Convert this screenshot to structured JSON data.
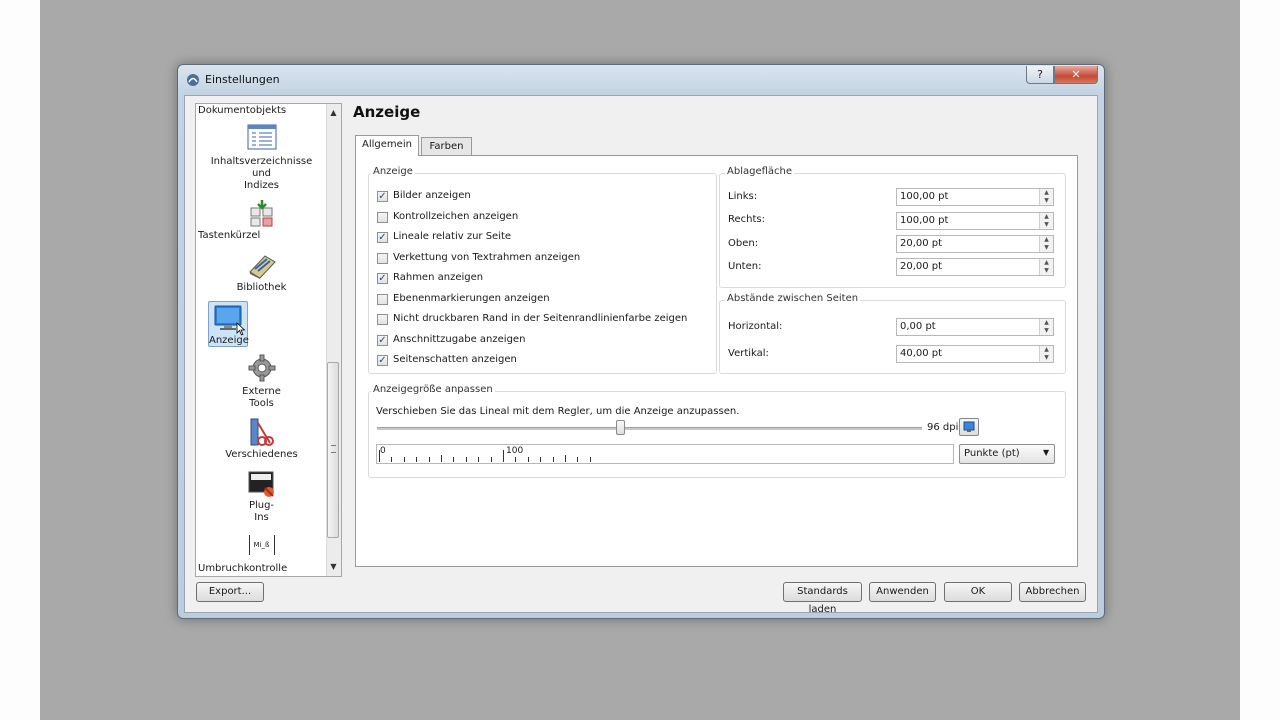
{
  "window": {
    "title": "Einstellungen",
    "help_label": "?",
    "close_label": "✕"
  },
  "sidebar": {
    "items": [
      {
        "label": "Dokumentobjekts",
        "icon": "none"
      },
      {
        "label": "Inhaltsverzeichnisse und Indizes",
        "label_lines": [
          "Inhaltsverzeichnisse",
          "und",
          "Indizes"
        ],
        "icon": "table-of-contents-icon"
      },
      {
        "label": "Tastenkürzel",
        "icon": "keyboard-shortcut-icon"
      },
      {
        "label": "Bibliothek",
        "icon": "library-icon"
      },
      {
        "label": "Anzeige",
        "icon": "monitor-icon",
        "selected": true
      },
      {
        "label": "Externe Tools",
        "label_lines": [
          "Externe",
          "Tools"
        ],
        "icon": "gear-icon"
      },
      {
        "label": "Verschiedenes",
        "icon": "misc-tools-icon"
      },
      {
        "label": "Plug-Ins",
        "label_lines": [
          "Plug-",
          "Ins"
        ],
        "icon": "plugin-icon"
      },
      {
        "label": "Umbruchkontrolle",
        "icon": "hyphenation-icon",
        "icon_text": "Mi_ß"
      }
    ]
  },
  "page": {
    "title": "Anzeige"
  },
  "tabs": [
    {
      "label": "Allgemein",
      "active": true
    },
    {
      "label": "Farben",
      "active": false
    }
  ],
  "anzeige": {
    "title": "Anzeige",
    "options": [
      {
        "label": "Bilder anzeigen",
        "checked": true
      },
      {
        "label": "Kontrollzeichen anzeigen",
        "checked": false
      },
      {
        "label": "Lineale relativ zur Seite",
        "checked": true
      },
      {
        "label": "Verkettung von Textrahmen anzeigen",
        "checked": false
      },
      {
        "label": "Rahmen anzeigen",
        "checked": true
      },
      {
        "label": "Ebenenmarkierungen anzeigen",
        "checked": false
      },
      {
        "label": "Nicht druckbaren Rand in der Seitenrandlinienfarbe zeigen",
        "checked": false
      },
      {
        "label": "Anschnittzugabe anzeigen",
        "checked": true
      },
      {
        "label": "Seitenschatten anzeigen",
        "checked": true
      }
    ]
  },
  "ablage": {
    "title": "Ablagefläche",
    "fields": [
      {
        "label": "Links:",
        "value": "100,00 pt"
      },
      {
        "label": "Rechts:",
        "value": "100,00 pt"
      },
      {
        "label": "Oben:",
        "value": "20,00 pt"
      },
      {
        "label": "Unten:",
        "value": "20,00 pt"
      }
    ]
  },
  "abstaende": {
    "title": "Abstände zwischen Seiten",
    "fields": [
      {
        "label": "Horizontal:",
        "value": "0,00 pt"
      },
      {
        "label": "Vertikal:",
        "value": "40,00 pt"
      }
    ]
  },
  "groesse": {
    "title": "Anzeigegröße anpassen",
    "hint": "Verschieben Sie das Lineal mit dem Regler, um die Anzeige anzupassen.",
    "dpi_label": "96 dpi",
    "slider_fraction": 0.445,
    "ruler_labels": [
      "0",
      "100"
    ],
    "unit_select": "Punkte (pt)"
  },
  "buttons": {
    "export": "Export...",
    "defaults": "Standards laden",
    "apply": "Anwenden",
    "ok": "OK",
    "cancel": "Abbrechen"
  },
  "colors": {
    "accent": "#3a78c4",
    "selection": "#cde3f8",
    "close": "#c64a36"
  }
}
